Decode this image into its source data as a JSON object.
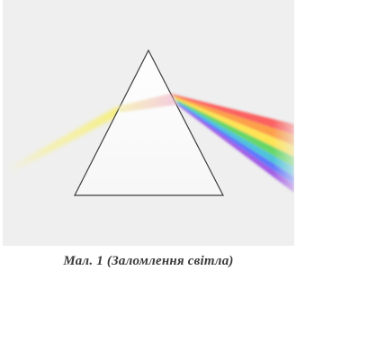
{
  "figure": {
    "caption": "Мал. 1 (Заломлення світла)"
  },
  "colors": {
    "panel_background": "#efefef",
    "prism_outline": "#3c3c3c",
    "incident_beam": "#f7ef7a",
    "spectrum": [
      "#ff2a2a",
      "#ff8a1f",
      "#ffe53a",
      "#4fd14a",
      "#2bb8d8",
      "#3b5bff",
      "#8a2be2"
    ]
  }
}
